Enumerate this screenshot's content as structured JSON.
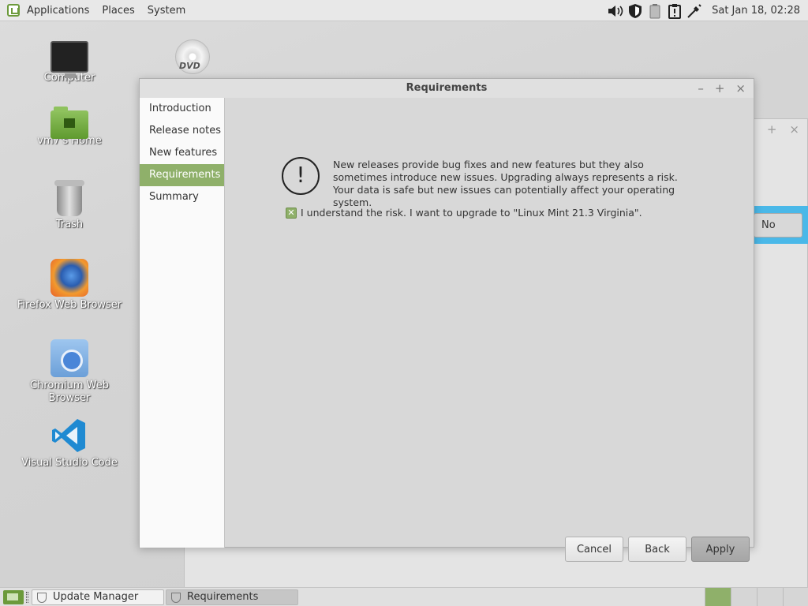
{
  "top_panel": {
    "menus": [
      "Applications",
      "Places",
      "System"
    ],
    "clock": "Sat Jan 18, 02:28",
    "tray_icons": [
      "volume-icon",
      "shield-icon",
      "battery-icon",
      "clipboard-alert-icon",
      "network-icon"
    ]
  },
  "desktop": {
    "icons": [
      {
        "label": "Computer",
        "icon": "computer-icon"
      },
      {
        "label": "vm7's Home",
        "icon": "home-folder-icon"
      },
      {
        "label": "Trash",
        "icon": "trash-icon"
      },
      {
        "label": "Firefox Web Browser",
        "icon": "firefox-icon"
      },
      {
        "label": "Chromium Web Browser",
        "icon": "chromium-icon"
      },
      {
        "label": "Visual Studio Code",
        "icon": "vscode-icon"
      }
    ],
    "dvd_label": "DVD"
  },
  "background_window": {
    "no_button": "No"
  },
  "dialog": {
    "title": "Requirements",
    "sidebar": [
      {
        "label": "Introduction",
        "active": false
      },
      {
        "label": "Release notes",
        "active": false
      },
      {
        "label": "New features",
        "active": false
      },
      {
        "label": "Requirements",
        "active": true
      },
      {
        "label": "Summary",
        "active": false
      }
    ],
    "warning_text": "New releases provide bug fixes and new features but they also sometimes introduce new issues. Upgrading always represents a risk. Your data is safe but new issues can potentially affect your operating system.",
    "checkbox_label": "I understand the risk. I want to upgrade to \"Linux Mint 21.3 Virginia\".",
    "checkbox_checked": true,
    "buttons": {
      "cancel": "Cancel",
      "back": "Back",
      "apply": "Apply"
    }
  },
  "taskbar": {
    "tasks": [
      {
        "label": "Update Manager",
        "active": false
      },
      {
        "label": "Requirements",
        "active": true
      }
    ]
  },
  "colors": {
    "accent": "#8fb06a",
    "mint_green": "#6c9a3b",
    "banner_blue": "#4ab8e8"
  }
}
